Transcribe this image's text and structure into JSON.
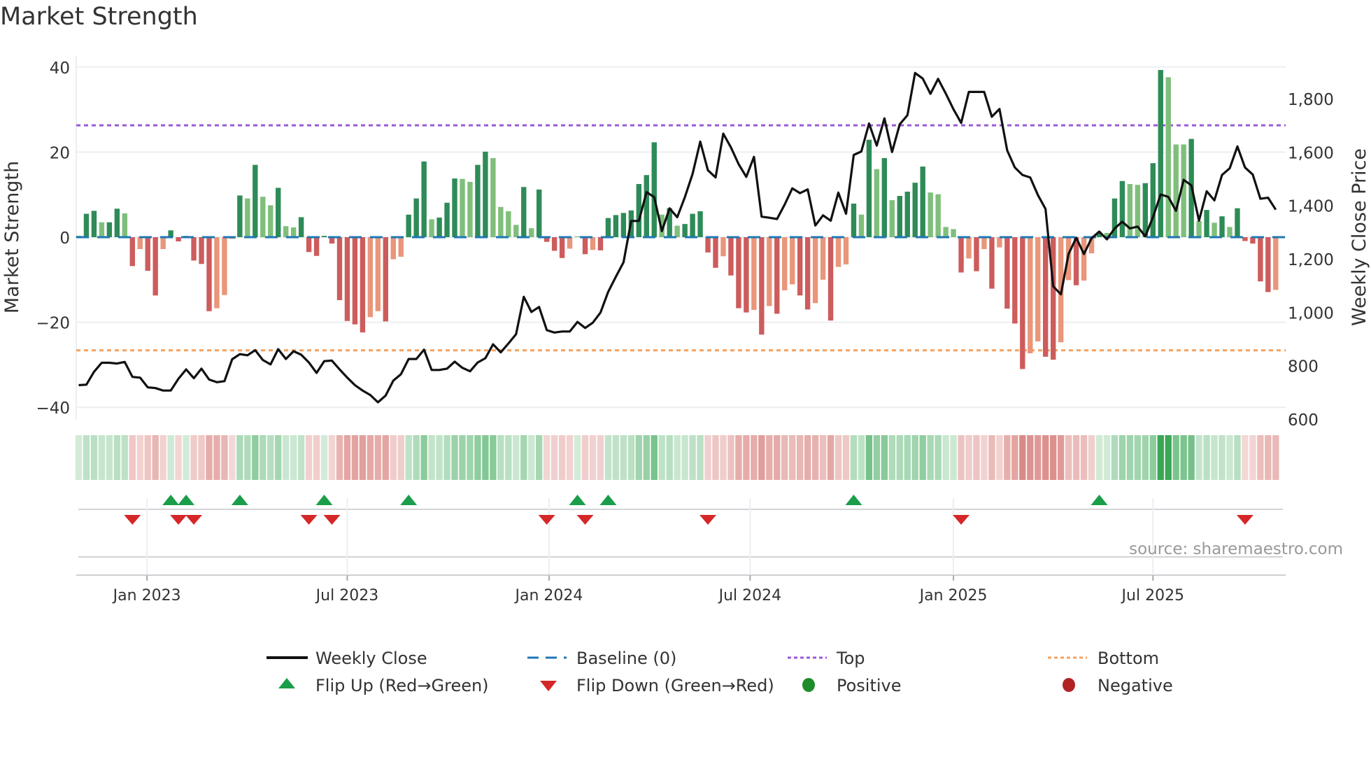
{
  "title": "Market Strength",
  "source": "source: sharemaestro.com",
  "colors": {
    "dark_green": "#2e8b57",
    "light_green": "#7fbf7b",
    "dark_red": "#cd5c5c",
    "light_red": "#e9967a",
    "line": "#111111",
    "baseline": "#1f77b4",
    "top": "#9b59d6",
    "bottom": "#f4a261",
    "flip_up": "#1a9e4a",
    "flip_down": "#d62728",
    "positive": "#1e8c2a",
    "negative": "#b22222"
  },
  "legend": {
    "weekly_close": "Weekly Close",
    "baseline": "Baseline (0)",
    "top": "Top",
    "bottom": "Bottom",
    "flip_up": "Flip Up (Red→Green)",
    "flip_down": "Flip Down (Green→Red)",
    "positive": "Positive",
    "negative": "Negative"
  },
  "chart_data": {
    "type": "bar",
    "title": "Market Strength",
    "ylabel": "Market Strength",
    "y2label": "Weekly Close Price",
    "ylim": [
      -42,
      42
    ],
    "y2lim": [
      600,
      1880
    ],
    "yticks": [
      "40",
      "20",
      "0",
      "−20",
      "−40"
    ],
    "ytick_values": [
      40,
      20,
      0,
      -20,
      -40
    ],
    "y2ticks": [
      "1,800",
      "1,600",
      "1,400",
      "1,200",
      "1,000",
      "800",
      "600"
    ],
    "y2tick_values": [
      1800,
      1600,
      1400,
      1200,
      1000,
      800,
      600
    ],
    "xticks": [
      "Jan 2023",
      "Jul 2023",
      "Jan 2024",
      "Jul 2024",
      "Jan 2025",
      "Jul 2025"
    ],
    "xtick_week_index": [
      8.9,
      35,
      61.3,
      87.5,
      114,
      140
    ],
    "top_level": 26.3,
    "bottom_level": -26.6,
    "strength": [
      0.3,
      5.5,
      6.2,
      3.5,
      3.5,
      6.7,
      5.6,
      -6.8,
      -2.8,
      -7.9,
      -13.7,
      -2.8,
      1.6,
      -1.0,
      0.3,
      -5.5,
      -6.3,
      -17.4,
      -16.7,
      -13.6,
      -0.4,
      9.8,
      9.1,
      17,
      9.5,
      7.5,
      11.6,
      2.6,
      2.3,
      4.7,
      -3.5,
      -4.4,
      0.3,
      -1.5,
      -14.8,
      -19.7,
      -20.5,
      -22.4,
      -18.8,
      -17.4,
      -19.8,
      -5.2,
      -4.6,
      5.3,
      9.1,
      17.8,
      4.2,
      4.6,
      8.1,
      13.8,
      13.7,
      13,
      17,
      20.1,
      18.6,
      7.1,
      6.1,
      2.9,
      11.8,
      2.1,
      11.2,
      -1.1,
      -3.2,
      -4.9,
      -2.7,
      0.2,
      -4,
      -3,
      -3.1,
      4.5,
      5.2,
      5.7,
      6.3,
      12.5,
      14.6,
      22.3,
      5.3,
      6.8,
      2.7,
      3.1,
      5.5,
      6.1,
      -3.6,
      -7.2,
      -4.5,
      -9,
      -16.7,
      -17.7,
      -17.1,
      -22.9,
      -16.2,
      -18,
      -12.5,
      -11.1,
      -13.7,
      -17,
      -15.5,
      -10,
      -19.6,
      -7,
      -6.4,
      7.9,
      5.3,
      22.9,
      16,
      18.6,
      8.7,
      9.7,
      10.7,
      12.8,
      16.6,
      10.5,
      10.1,
      2.4,
      1.9,
      -8.3,
      -5,
      -8,
      -2.8,
      -12.1,
      -2.4,
      -16.8,
      -20.3,
      -31,
      -27.3,
      -24.5,
      -28.1,
      -28.8,
      -24.7,
      -10.1,
      -11.3,
      -10.2,
      -3.8,
      0.9,
      1,
      9.1,
      13.2,
      12.5,
      12.3,
      12.7,
      17.4,
      39.3,
      37.6,
      21.8,
      21.8,
      23.1,
      3.8,
      6.4,
      3.4,
      4.9,
      2.4,
      6.8,
      -0.9,
      -1.5,
      -10.4,
      -12.9,
      -12.4
    ],
    "strength_dark_shade": [
      1,
      1,
      1,
      0,
      1,
      1,
      0,
      1,
      0,
      1,
      1,
      0,
      1,
      1,
      1,
      1,
      1,
      1,
      0,
      0,
      0,
      1,
      0,
      1,
      0,
      0,
      1,
      0,
      0,
      1,
      1,
      1,
      1,
      1,
      1,
      1,
      1,
      1,
      0,
      0,
      1,
      0,
      0,
      1,
      1,
      1,
      0,
      1,
      1,
      1,
      0,
      0,
      1,
      1,
      0,
      0,
      0,
      0,
      1,
      0,
      1,
      1,
      1,
      1,
      0,
      0,
      1,
      0,
      1,
      1,
      1,
      1,
      1,
      1,
      1,
      1,
      0,
      1,
      0,
      1,
      1,
      1,
      1,
      1,
      0,
      1,
      1,
      1,
      0,
      1,
      0,
      1,
      0,
      0,
      1,
      1,
      0,
      0,
      1,
      0,
      0,
      1,
      0,
      1,
      0,
      1,
      0,
      1,
      1,
      1,
      1,
      0,
      0,
      0,
      0,
      1,
      0,
      1,
      0,
      1,
      0,
      1,
      1,
      1,
      0,
      0,
      1,
      1,
      0,
      0,
      1,
      0,
      0,
      1,
      0,
      1,
      1,
      0,
      0,
      1,
      1,
      1,
      0,
      0,
      0,
      1,
      0,
      1,
      0,
      1,
      0,
      1,
      1,
      1,
      1,
      1,
      0
    ],
    "weekly_close": [
      727,
      729,
      777,
      811,
      811,
      808,
      814,
      758,
      755,
      719,
      716,
      707,
      707,
      751,
      786,
      753,
      789,
      748,
      738,
      742,
      824,
      843,
      839,
      858,
      821,
      805,
      862,
      825,
      854,
      841,
      812,
      773,
      817,
      819,
      786,
      755,
      727,
      707,
      690,
      663,
      688,
      744,
      768,
      825,
      825,
      860,
      784,
      784,
      789,
      815,
      792,
      779,
      812,
      828,
      880,
      850,
      883,
      918,
      1058,
      1001,
      1020,
      933,
      924,
      928,
      928,
      964,
      941,
      961,
      999,
      1076,
      1133,
      1187,
      1342,
      1342,
      1450,
      1431,
      1304,
      1389,
      1356,
      1431,
      1518,
      1639,
      1532,
      1505,
      1669,
      1617,
      1555,
      1507,
      1582,
      1358,
      1354,
      1349,
      1403,
      1464,
      1446,
      1460,
      1325,
      1363,
      1343,
      1448,
      1369,
      1589,
      1602,
      1707,
      1624,
      1726,
      1600,
      1704,
      1738,
      1896,
      1875,
      1818,
      1874,
      1819,
      1760,
      1709,
      1825,
      1825,
      1825,
      1732,
      1761,
      1606,
      1542,
      1514,
      1505,
      1439,
      1387,
      1097,
      1067,
      1218,
      1279,
      1218,
      1277,
      1302,
      1273,
      1314,
      1339,
      1314,
      1321,
      1284,
      1356,
      1441,
      1432,
      1380,
      1496,
      1475,
      1343,
      1453,
      1419,
      1514,
      1539,
      1621,
      1542,
      1516,
      1425,
      1429,
      1384
    ],
    "flip_up_week_index": [
      12,
      14,
      21,
      32,
      43,
      65,
      69,
      101,
      133
    ],
    "flip_down_week_index": [
      7,
      13,
      15,
      30,
      33,
      61,
      66,
      82,
      115,
      152
    ],
    "legend_placement": "bottom",
    "grid": true
  }
}
